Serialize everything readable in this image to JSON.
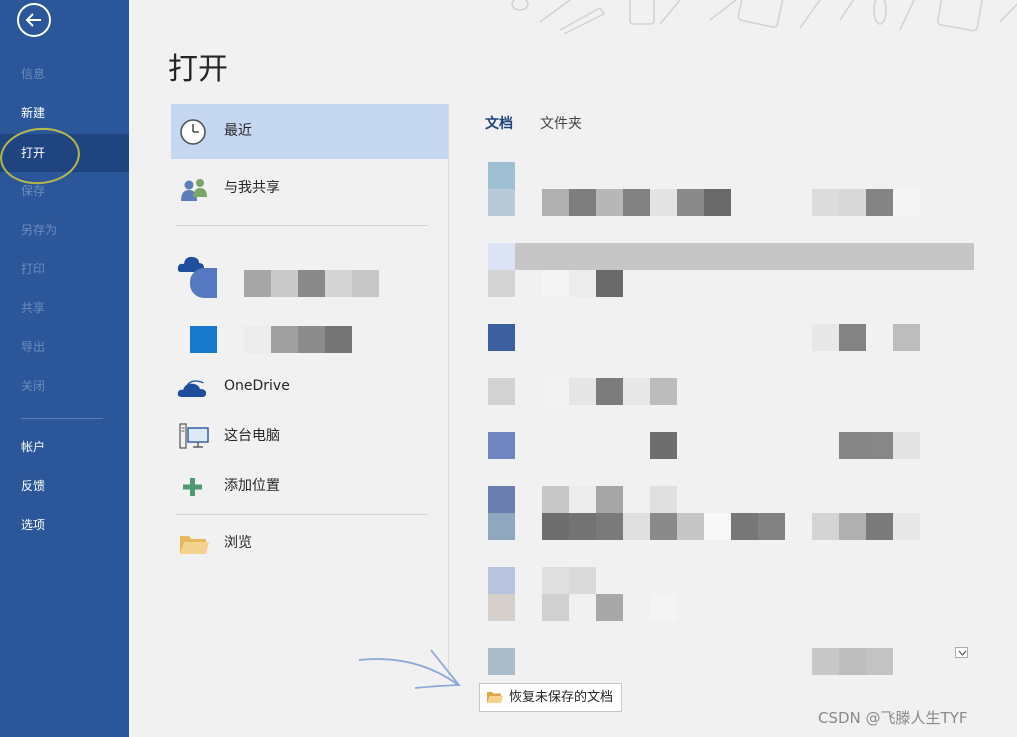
{
  "sidebar": {
    "items": [
      {
        "label": "信息",
        "state": "disabled"
      },
      {
        "label": "新建",
        "state": "enabled"
      },
      {
        "label": "打开",
        "state": "active"
      },
      {
        "label": "保存",
        "state": "disabled"
      },
      {
        "label": "另存为",
        "state": "disabled"
      },
      {
        "label": "打印",
        "state": "disabled"
      },
      {
        "label": "共享",
        "state": "disabled"
      },
      {
        "label": "导出",
        "state": "disabled"
      },
      {
        "label": "关闭",
        "state": "disabled"
      },
      {
        "label": "帐户",
        "state": "enabled"
      },
      {
        "label": "反馈",
        "state": "enabled"
      },
      {
        "label": "选项",
        "state": "enabled"
      }
    ]
  },
  "page": {
    "title": "打开"
  },
  "locations": {
    "recent": {
      "label": "最近",
      "icon": "clock-icon"
    },
    "shared": {
      "label": "与我共享",
      "icon": "people-icon"
    },
    "onedrive": {
      "label": "OneDrive",
      "icon": "onedrive-cloud-icon"
    },
    "this_pc": {
      "label": "这台电脑",
      "icon": "computer-icon"
    },
    "add_place": {
      "label": "添加位置",
      "icon": "plus-icon"
    },
    "browse": {
      "label": "浏览",
      "icon": "folder-icon"
    }
  },
  "tabs": {
    "documents": "文档",
    "folders": "文件夹"
  },
  "recover_button": {
    "label": "恢复未保存的文档",
    "icon": "folder-open-icon"
  },
  "watermark": "CSDN @飞滕人生TYF",
  "colors": {
    "sidebar": "#2b579a",
    "sidebar_active": "#1f447f",
    "selected_location": "#c5d7f1",
    "annotation_circle": "#b6b84a",
    "annotation_arrow": "#8ea6d8"
  }
}
